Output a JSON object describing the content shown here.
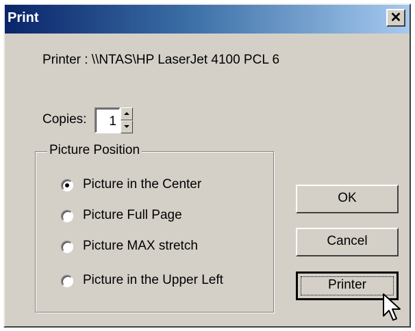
{
  "window": {
    "title": "Print",
    "close_glyph": "✕"
  },
  "printer": {
    "label": "Printer : \\\\NTAS\\HP LaserJet 4100 PCL 6"
  },
  "copies": {
    "label": "Copies:",
    "value": "1"
  },
  "picture_position": {
    "title": "Picture Position",
    "options": [
      {
        "label": "Picture in the Center",
        "selected": true
      },
      {
        "label": "Picture Full Page",
        "selected": false
      },
      {
        "label": "Picture MAX stretch",
        "selected": false
      },
      {
        "label": "Picture in the Upper Left",
        "selected": false
      }
    ]
  },
  "buttons": {
    "ok": "OK",
    "cancel": "Cancel",
    "printer": "Printer"
  },
  "colors": {
    "face": "#d4d0c8",
    "title_start": "#0a246a",
    "title_end": "#a6caf0"
  },
  "icons": [
    "close-icon",
    "spin-up-icon",
    "spin-down-icon",
    "mouse-pointer-icon"
  ]
}
